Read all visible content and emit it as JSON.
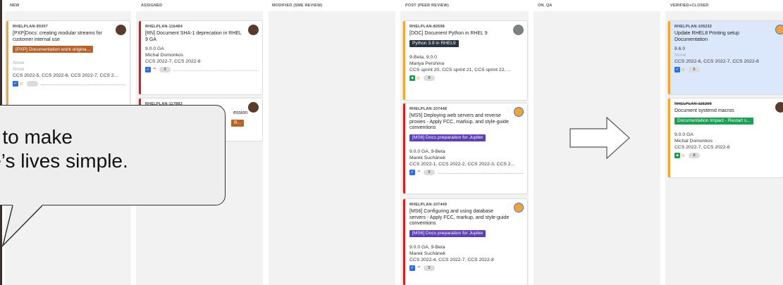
{
  "columns": [
    {
      "label": "NEW"
    },
    {
      "label": "ASSIGNED"
    },
    {
      "label": "MODIFIED (SME REVIEW)"
    },
    {
      "label": "POST (PEER REVIEW)"
    },
    {
      "label": "ON_QA"
    },
    {
      "label": "VERIFIED+CLOSED"
    }
  ],
  "cards": {
    "c1": {
      "id": "RHELPLAN-99307",
      "title": "[PXP]Docs: creating modular streams for customer internal use",
      "tag": "[PXP] Documentation work origina...",
      "l1": "None",
      "l2": "None",
      "l3": "CCS 2022-5, CCS 2022-6, CCS 2022-7, CCS 2..."
    },
    "c2": {
      "id": "RHELPLAN-116484",
      "title": "[RN] Document SHA-1 deprecation in RHEL 9 GA",
      "l1": "9.0.0 GA",
      "l2": "Michal Domonkos",
      "l3": "CCS 2022-7, CCS 2022-8",
      "count": "3"
    },
    "c3": {
      "id": "RHELPLAN-117883",
      "title": "ession",
      "tag": "R..."
    },
    "c4": {
      "id": "RHELPLAN-80598",
      "title": "[DOC] Document Python in RHEL 9",
      "tag": "Python 3.9 in RHEL9",
      "l1": "9-Beta, 9.0.0",
      "l2": "Mariya Pershina",
      "l3": "CCS sprint 20, CCS sprint 21, CCS sprint 22, ...",
      "count": "8"
    },
    "c5": {
      "id": "RHELPLAN-107448",
      "title": "[MS5] Deploying web servers and reverse proxies - Apply FCC, markup, and style-guide conventions",
      "tag": "[MS6] Docs preparation for Jupiter",
      "l1": "9.0.0 GA, 9-Beta",
      "l2": "Marek Suchánek",
      "l3": "CCS 2022-1, CCS 2022-2, CCS 2022-3, CCS 2...",
      "count": "5"
    },
    "c6": {
      "id": "RHELPLAN-107449",
      "title": "[MS6] Configuring and using database servers - Apply FCC, markup, and style-guide conventions",
      "tag": "[MS6] Docs preparation for Jupiter",
      "l1": "9.0.0 GA, 9-Beta",
      "l2": "Marek Suchánek",
      "l3": "CCS 2022-4, CCS 2022-7, CCS 2022-8",
      "count": "5"
    },
    "c7": {
      "id": "RHELPLAN-105232",
      "title": "Update RHEL8 Printing setup Documentation",
      "l1": "8.6.0",
      "l2": "None",
      "l3": "CCS 2022-6, CCS 2022-7, CCS 2022-8",
      "count": "5"
    },
    "c8": {
      "id": "RHELPLAN-115298",
      "title": "Document systemd macros",
      "tag": "Documentation Impact - Restart s...",
      "l1": "9.0.0 GA",
      "l2": "Michal Domonkos",
      "l3": "CCS 2022-7, CCS 2022-8",
      "count": "8"
    }
  },
  "bubble": {
    "text": "e to make\nle’s lives simple."
  },
  "colors": {
    "accent_orange": "#f0a830",
    "accent_red": "#d42020",
    "tag_purple": "#5e3fb4",
    "tag_green": "#1f9e55"
  }
}
